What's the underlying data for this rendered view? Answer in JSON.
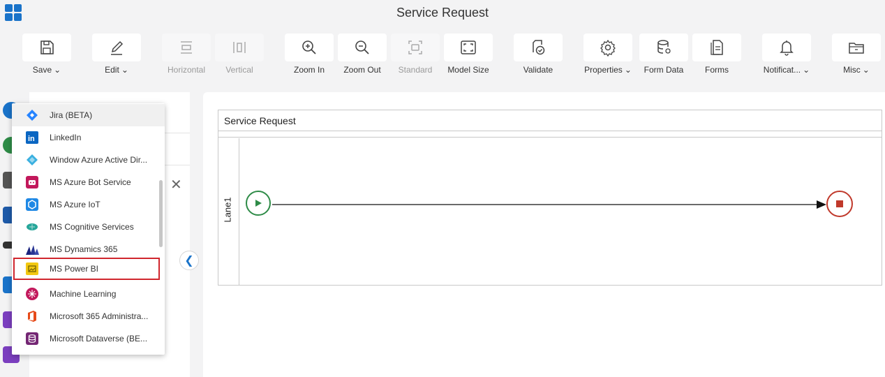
{
  "app": {
    "title": "Service Request"
  },
  "toolbar": {
    "items": [
      {
        "label": "Save",
        "dropdown": true,
        "icon": "save-icon"
      },
      {
        "label": "Edit",
        "dropdown": true,
        "icon": "edit-icon"
      },
      {
        "label": "Horizontal",
        "disabled": true,
        "icon": "horizontal-icon"
      },
      {
        "label": "Vertical",
        "disabled": true,
        "icon": "vertical-icon"
      },
      {
        "label": "Zoom In",
        "icon": "zoom-in-icon"
      },
      {
        "label": "Zoom Out",
        "icon": "zoom-out-icon"
      },
      {
        "label": "Standard",
        "disabled": true,
        "icon": "standard-icon"
      },
      {
        "label": "Model Size",
        "icon": "model-size-icon"
      },
      {
        "label": "Validate",
        "icon": "validate-icon"
      },
      {
        "label": "Properties",
        "dropdown": true,
        "icon": "gear-icon"
      },
      {
        "label": "Form Data",
        "icon": "database-icon"
      },
      {
        "label": "Forms",
        "icon": "forms-icon"
      },
      {
        "label": "Notificat...",
        "dropdown": true,
        "icon": "bell-icon"
      },
      {
        "label": "Misc",
        "dropdown": true,
        "icon": "folder-icon"
      }
    ]
  },
  "dropdown": {
    "items": [
      {
        "label": "Jira (BETA)",
        "icon": "jira-icon",
        "color": "#2684ff"
      },
      {
        "label": "LinkedIn",
        "icon": "linkedin-icon",
        "color": "#0a66c2"
      },
      {
        "label": "Window Azure Active Dir...",
        "icon": "azure-ad-icon",
        "color": "#3ab0e0"
      },
      {
        "label": "MS Azure Bot Service",
        "icon": "bot-icon",
        "color": "#c2185b"
      },
      {
        "label": "MS Azure IoT",
        "icon": "iot-icon",
        "color": "#1e88e5"
      },
      {
        "label": "MS Cognitive Services",
        "icon": "brain-icon",
        "color": "#26a69a"
      },
      {
        "label": "MS Dynamics 365",
        "icon": "dynamics-icon",
        "color": "#1a237e"
      },
      {
        "label": "MS Power BI",
        "icon": "powerbi-icon",
        "color": "#f2c811",
        "selected": true
      },
      {
        "label": "Machine Learning",
        "icon": "ml-icon",
        "color": "#c2185b"
      },
      {
        "label": "Microsoft 365 Administra...",
        "icon": "office-icon",
        "color": "#e64a19"
      },
      {
        "label": "Microsoft Dataverse (BE...",
        "icon": "dataverse-icon",
        "color": "#742774"
      }
    ]
  },
  "diagram": {
    "pool_name": "Service Request",
    "lane_name": "Lane1"
  },
  "colors": {
    "start_event": "#2e8b47",
    "end_event": "#c0392b",
    "selection_border": "#d0262d",
    "accent": "#1a73c9"
  }
}
